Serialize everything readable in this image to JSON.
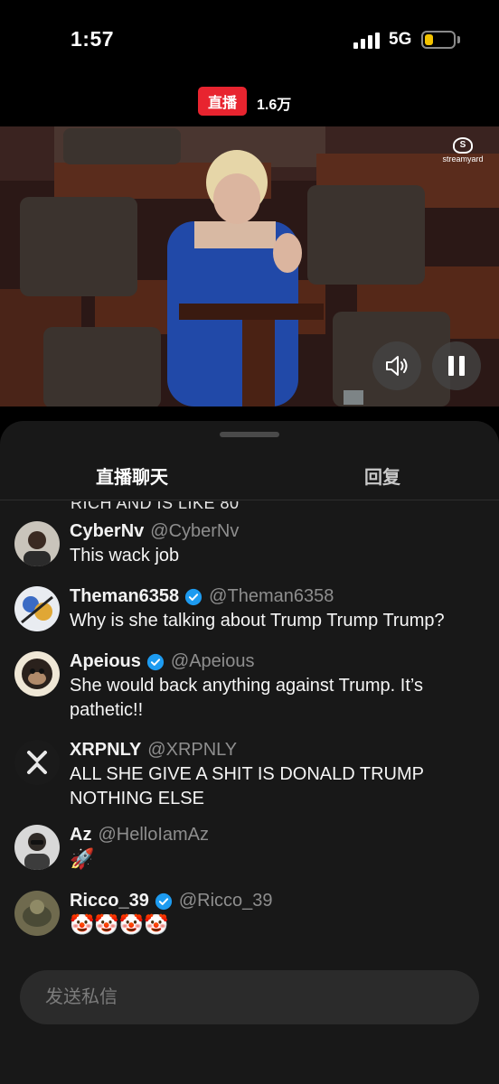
{
  "status_bar": {
    "time": "1:57",
    "network": "5G",
    "battery_level": 0.3,
    "battery_color": "#f2c200"
  },
  "live": {
    "badge_label": "直播",
    "badge_color": "#e8242f",
    "viewers": "1.6万"
  },
  "video": {
    "watermark_text": "streamyard",
    "controls": [
      "speaker-icon",
      "pause-icon"
    ]
  },
  "tabs": [
    {
      "label": "直播聊天",
      "active": true
    },
    {
      "label": "回复",
      "active": false
    }
  ],
  "chat": {
    "truncated_line": "RICH AND IS LIKE 80",
    "messages": [
      {
        "name": "CyberNv",
        "handle": "@CyberNv",
        "verified": false,
        "text": "This wack job"
      },
      {
        "name": "Theman6358",
        "handle": "@Theman6358",
        "verified": true,
        "text": "Why is she talking about Trump Trump Trump?"
      },
      {
        "name": "Apeious",
        "handle": "@Apeious",
        "verified": true,
        "text": "She would back anything against Trump. It’s pathetic!!"
      },
      {
        "name": "XRPNLY",
        "handle": "@XRPNLY",
        "verified": false,
        "text": "ALL SHE GIVE A SHIT IS DONALD TRUMP NOTHING ELSE"
      },
      {
        "name": "Az",
        "handle": "@HelloIamAz",
        "verified": false,
        "text": "🚀"
      },
      {
        "name": "Ricco_39",
        "handle": "@Ricco_39",
        "verified": true,
        "text": "🤡🤡🤡🤡"
      }
    ]
  },
  "compose": {
    "placeholder": "发送私信"
  },
  "colors": {
    "verified": "#1d9bf0",
    "sheet_bg": "#181818"
  }
}
